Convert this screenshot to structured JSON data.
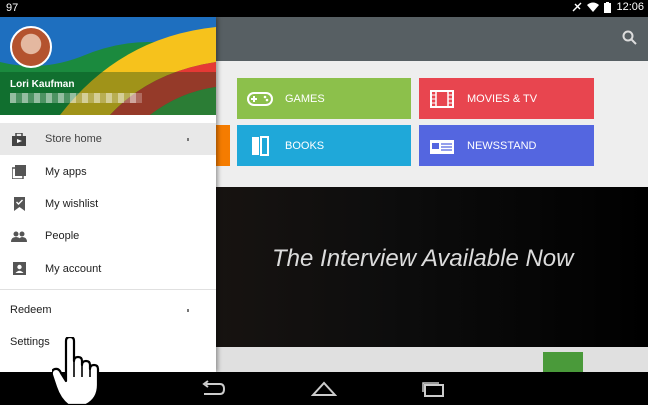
{
  "status_bar": {
    "left_text": "97",
    "time": "12:06"
  },
  "drawer": {
    "user_name": "Lori Kaufman",
    "nav_items": [
      {
        "label": "Store home",
        "icon": "store-home-icon"
      },
      {
        "label": "My apps",
        "icon": "my-apps-icon"
      },
      {
        "label": "My wishlist",
        "icon": "wishlist-icon"
      },
      {
        "label": "People",
        "icon": "people-icon"
      },
      {
        "label": "My account",
        "icon": "account-icon"
      }
    ],
    "secondary_items": [
      {
        "label": "Redeem"
      },
      {
        "label": "Settings"
      }
    ]
  },
  "tiles": [
    {
      "label": "GAMES",
      "color": "#8cc04b",
      "icon": "gamepad-icon"
    },
    {
      "label": "MOVIES & TV",
      "color": "#e8454f",
      "icon": "film-icon"
    },
    {
      "label": "BOOKS",
      "color": "#1fa8d9",
      "icon": "book-icon"
    },
    {
      "label": "NEWSSTAND",
      "color": "#5466e0",
      "icon": "newsstand-icon"
    }
  ],
  "banner": {
    "text": "The Interview Available Now"
  },
  "colors": {
    "action_bar": "#575f63",
    "drawer_selected": "#e8e8e8",
    "partial_tile": "#f57c00"
  }
}
